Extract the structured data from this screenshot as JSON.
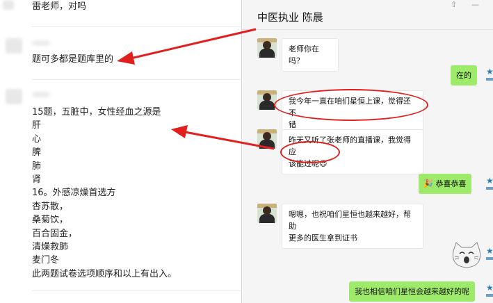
{
  "left_panel": {
    "top_text": "雷老师，对吗",
    "msg1_text": "题可多都是题库里的",
    "msg2_lines": [
      "15题，五脏中，女性经血之源是",
      "肝",
      "心",
      "脾",
      "肺",
      "肾",
      "16。外感凉燥首选方",
      "杏苏散，",
      "桑菊饮，",
      "百合固金，",
      "清燥救肺",
      "麦门冬",
      "此两题试卷选项顺序和以上有出入。"
    ]
  },
  "chat": {
    "title": "中医执业 陈晨",
    "window_buttons": [
      "⇧",
      "—"
    ],
    "messages": [
      {
        "side": "left",
        "lines": [
          "老师你在吗？"
        ]
      },
      {
        "side": "right",
        "text": "在的"
      },
      {
        "side": "left",
        "lines": [
          "我今年一直在咱们星恒上课，觉得还不",
          "错"
        ]
      },
      {
        "side": "left",
        "lines": [
          "昨天又听了张老师的直播课，我觉得应",
          "该能过呢"
        ],
        "emoji": "😍"
      },
      {
        "side": "right",
        "text": "恭喜恭喜",
        "sticker": "🎉"
      },
      {
        "side": "left",
        "lines": [
          "嗯嗯，也祝咱们星恒也越来越好，帮助",
          "更多的医生拿到证书"
        ]
      },
      {
        "side": "right",
        "text": "我也相信咱们星恒会越来越好的呢"
      }
    ]
  },
  "colors": {
    "annotation_red": "#e11f1f",
    "bubble_green": "#9eea6a"
  }
}
